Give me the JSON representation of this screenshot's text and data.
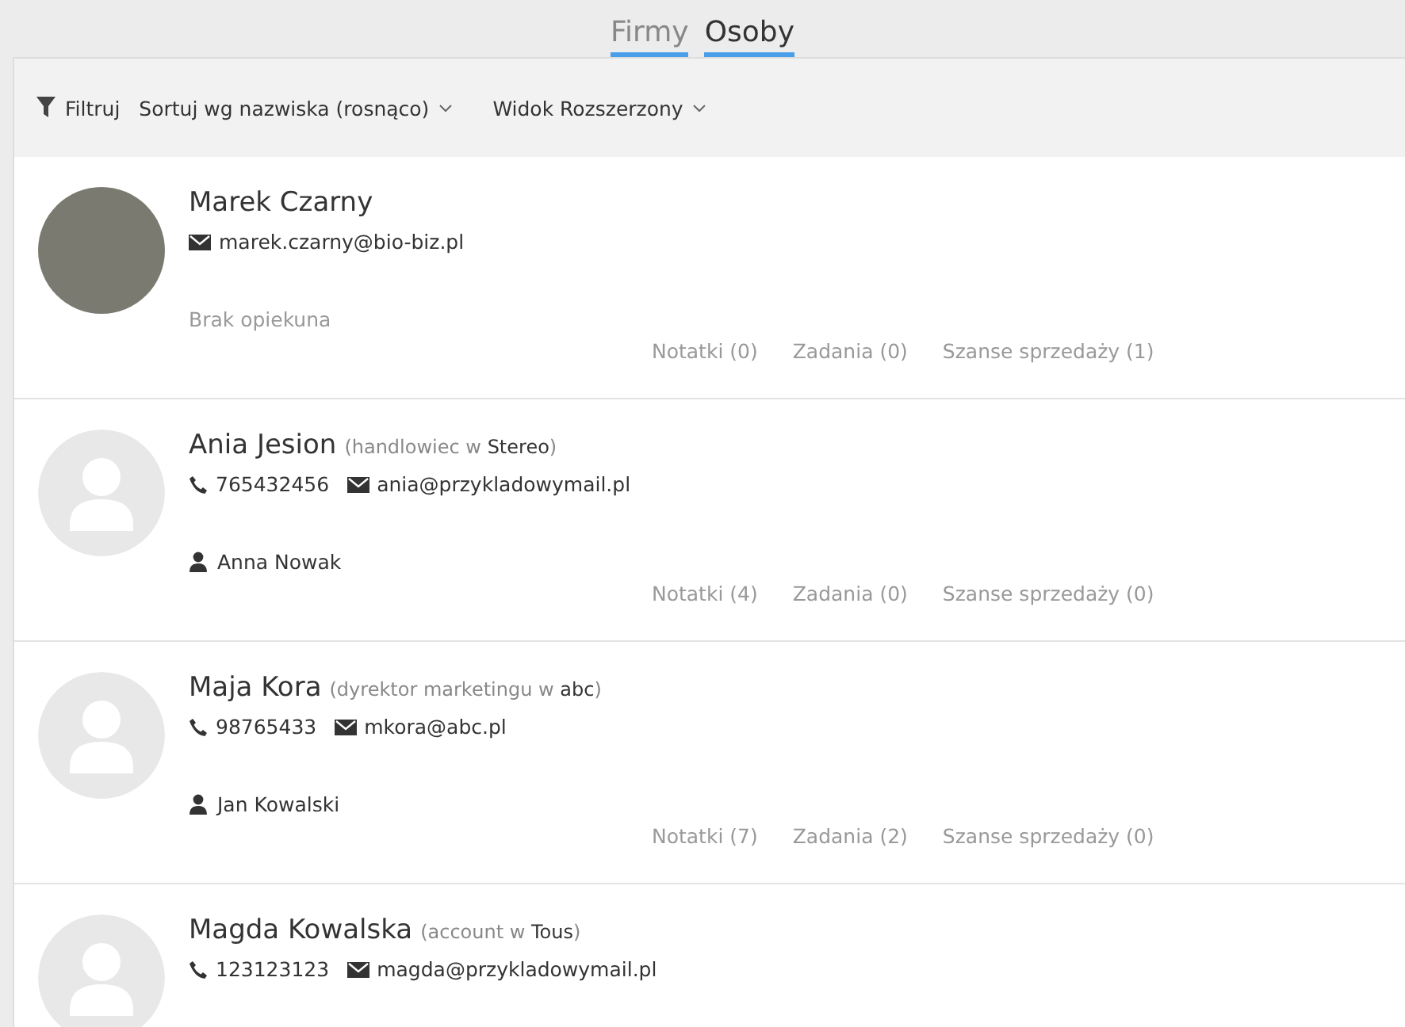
{
  "tabs": [
    {
      "label": "Firmy",
      "selected": false
    },
    {
      "label": "Osoby",
      "selected": true
    }
  ],
  "toolbar": {
    "filter": "Filtruj",
    "sort": "Sortuj wg nazwiska (rosnąco)",
    "view": "Widok Rozszerzony"
  },
  "contacts": [
    {
      "name": "Marek Czarny",
      "avatar": {
        "kind": "photo"
      },
      "email": "marek.czarny@bio-biz.pl",
      "owner": {
        "name": "Brak opiekuna",
        "assigned": false
      },
      "stats": [
        "Notatki (0)",
        "Zadania (0)",
        "Szanse sprzedaży (1)"
      ]
    },
    {
      "name": "Ania Jesion",
      "role": "(handlowiec w **Stereo**)",
      "avatar": {
        "kind": "placeholder"
      },
      "phone": "765432456",
      "email": "ania@przykladowymail.pl",
      "owner": {
        "name": "Anna Nowak",
        "assigned": true
      },
      "stats": [
        "Notatki (4)",
        "Zadania (0)",
        "Szanse sprzedaży (0)"
      ]
    },
    {
      "name": "Maja Kora",
      "role": "(dyrektor marketingu w **abc**)",
      "avatar": {
        "kind": "placeholder"
      },
      "phone": "98765433",
      "email": "mkora@abc.pl",
      "owner": {
        "name": "Jan Kowalski",
        "assigned": true
      },
      "stats": [
        "Notatki (7)",
        "Zadania (2)",
        "Szanse sprzedaży (0)"
      ]
    },
    {
      "name": "Magda Kowalska",
      "role": "(account w **Tous**)",
      "avatar": {
        "kind": "placeholder"
      },
      "phone": "123123123",
      "email": "magda@przykladowymail.pl"
    }
  ]
}
